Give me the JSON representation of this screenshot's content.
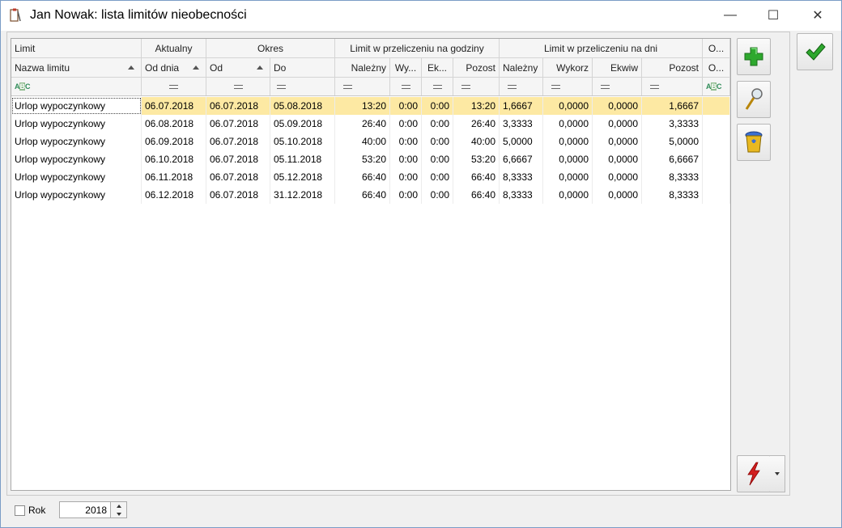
{
  "window": {
    "title": "Jan Nowak: lista limitów nieobecności",
    "min_glyph": "—",
    "max_glyph": "☐",
    "close_glyph": "✕"
  },
  "grid": {
    "group_headers": [
      "Limit",
      "Aktualny",
      "Okres",
      "Limit w przeliczeniu na godziny",
      "Limit w przeliczeniu na dni",
      "O..."
    ],
    "columns": [
      "Nazwa limitu",
      "Od dnia",
      "Od",
      "Do",
      "Należny",
      "Wy...",
      "Ek...",
      "Pozost",
      "Należny",
      "Wykorz",
      "Ekwiw",
      "Pozost",
      "O..."
    ],
    "rows": [
      [
        "Urlop wypoczynkowy",
        "06.07.2018",
        "06.07.2018",
        "05.08.2018",
        "13:20",
        "0:00",
        "0:00",
        "13:20",
        "1,6667",
        "0,0000",
        "0,0000",
        "1,6667",
        ""
      ],
      [
        "Urlop wypoczynkowy",
        "06.08.2018",
        "06.07.2018",
        "05.09.2018",
        "26:40",
        "0:00",
        "0:00",
        "26:40",
        "3,3333",
        "0,0000",
        "0,0000",
        "3,3333",
        ""
      ],
      [
        "Urlop wypoczynkowy",
        "06.09.2018",
        "06.07.2018",
        "05.10.2018",
        "40:00",
        "0:00",
        "0:00",
        "40:00",
        "5,0000",
        "0,0000",
        "0,0000",
        "5,0000",
        ""
      ],
      [
        "Urlop wypoczynkowy",
        "06.10.2018",
        "06.07.2018",
        "05.11.2018",
        "53:20",
        "0:00",
        "0:00",
        "53:20",
        "6,6667",
        "0,0000",
        "0,0000",
        "6,6667",
        ""
      ],
      [
        "Urlop wypoczynkowy",
        "06.11.2018",
        "06.07.2018",
        "05.12.2018",
        "66:40",
        "0:00",
        "0:00",
        "66:40",
        "8,3333",
        "0,0000",
        "0,0000",
        "8,3333",
        ""
      ],
      [
        "Urlop wypoczynkowy",
        "06.12.2018",
        "06.07.2018",
        "31.12.2018",
        "66:40",
        "0:00",
        "0:00",
        "66:40",
        "8,3333",
        "0,0000",
        "0,0000",
        "8,3333",
        ""
      ]
    ],
    "selected_row": 0,
    "filter_icons": [
      "abc-icon",
      "equals-icon",
      "equals-icon",
      "equals-icon",
      "equals-icon",
      "equals-icon",
      "equals-icon",
      "equals-icon",
      "equals-icon",
      "equals-icon",
      "equals-icon",
      "equals-icon",
      "abc-icon"
    ]
  },
  "side_buttons": {
    "add": "plus-icon",
    "preview": "magnifier-icon",
    "delete": "trash-icon",
    "action": "lightning-icon",
    "confirm": "checkmark-icon"
  },
  "bottom": {
    "year_checkbox_label": "Rok",
    "year_value": "2018"
  },
  "colors": {
    "selected_row": "#fde9a3",
    "accent_green": "#2ea82e",
    "lightning_red": "#d21f1f"
  }
}
